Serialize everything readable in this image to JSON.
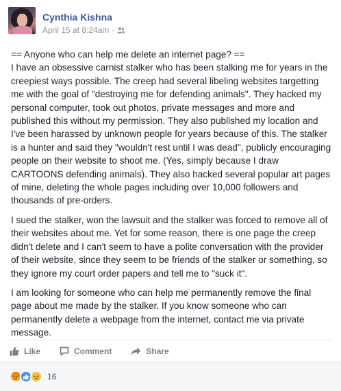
{
  "post": {
    "author": "Cynthia Kishna",
    "date": "April 15 at 8:24am",
    "separator": "·",
    "audience_icon": "friends-icon",
    "paragraphs": [
      "== Anyone who can help me delete an internet page? ==\nI have an obsessive carnist stalker who has been stalking me for years in the creepiest ways possible. The creep had several libeling websites targetting me with the goal of \"destroying me for defending animals\". They hacked my personal computer, took out photos, private messages and more and published this without my permission. They also published my location and I've been harassed by unknown people for years because of this. The stalker is a hunter and said they \"wouldn't rest until I was dead\", publicly encouraging people on their website to shoot me. (Yes, simply because I draw CARTOONS defending animals). They also hacked several popular art pages of mine, deleting the whole pages including over 10,000 followers and thousands of pre-orders.",
      "I sued the stalker, won the lawsuit and the stalker was forced to remove all of their websites about me. Yet for some reason, there is one page the creep didn't delete and I can't seem to have a polite conversation with the provider of their website, since they seem to be friends of the stalker or something, so they ignore my court order papers and tell me to \"suck it\".",
      "I am looking for someone who can help me permanently remove the final page about me made by the stalker. If you know someone who can permanently delete a webpage from the internet, contact me via private message."
    ]
  },
  "actions": {
    "like": "Like",
    "comment": "Comment",
    "share": "Share"
  },
  "reactions": {
    "types": [
      "angry",
      "like",
      "sad"
    ],
    "count": "16"
  },
  "colors": {
    "name": "#365899",
    "text": "#1d2129",
    "meta": "#90949c",
    "action": "#7f7f7f"
  }
}
